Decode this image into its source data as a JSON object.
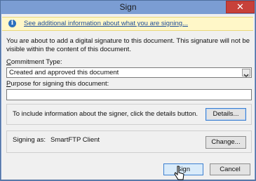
{
  "window": {
    "title": "Sign",
    "close_glyph": "✕"
  },
  "infobar": {
    "icon": "info-icon",
    "icon_glyph": "i",
    "link_text": "See additional information about what you are signing..."
  },
  "intro_text": "You are about to add a digital signature to this document. This signature will not be visible within the content of this document.",
  "commitment": {
    "label_prefix": "C",
    "label_rest": "ommitment Type:",
    "selected_value": "Created and approved this document"
  },
  "purpose": {
    "label_prefix": "P",
    "label_rest": "urpose for signing this document:",
    "value": ""
  },
  "details_section": {
    "text": "To include information about the signer, click the details button.",
    "button_label": "Details..."
  },
  "signing_section": {
    "label": "Signing as:",
    "value": "SmartFTP Client",
    "button_label": "Change..."
  },
  "footer": {
    "sign_label": "Sign",
    "cancel_label": "Cancel"
  },
  "colors": {
    "titlebar": "#7b9dd3",
    "close": "#c7413a",
    "infobar": "#fff7c8",
    "link": "#1f4f9a",
    "focus": "#3c7fd0"
  }
}
